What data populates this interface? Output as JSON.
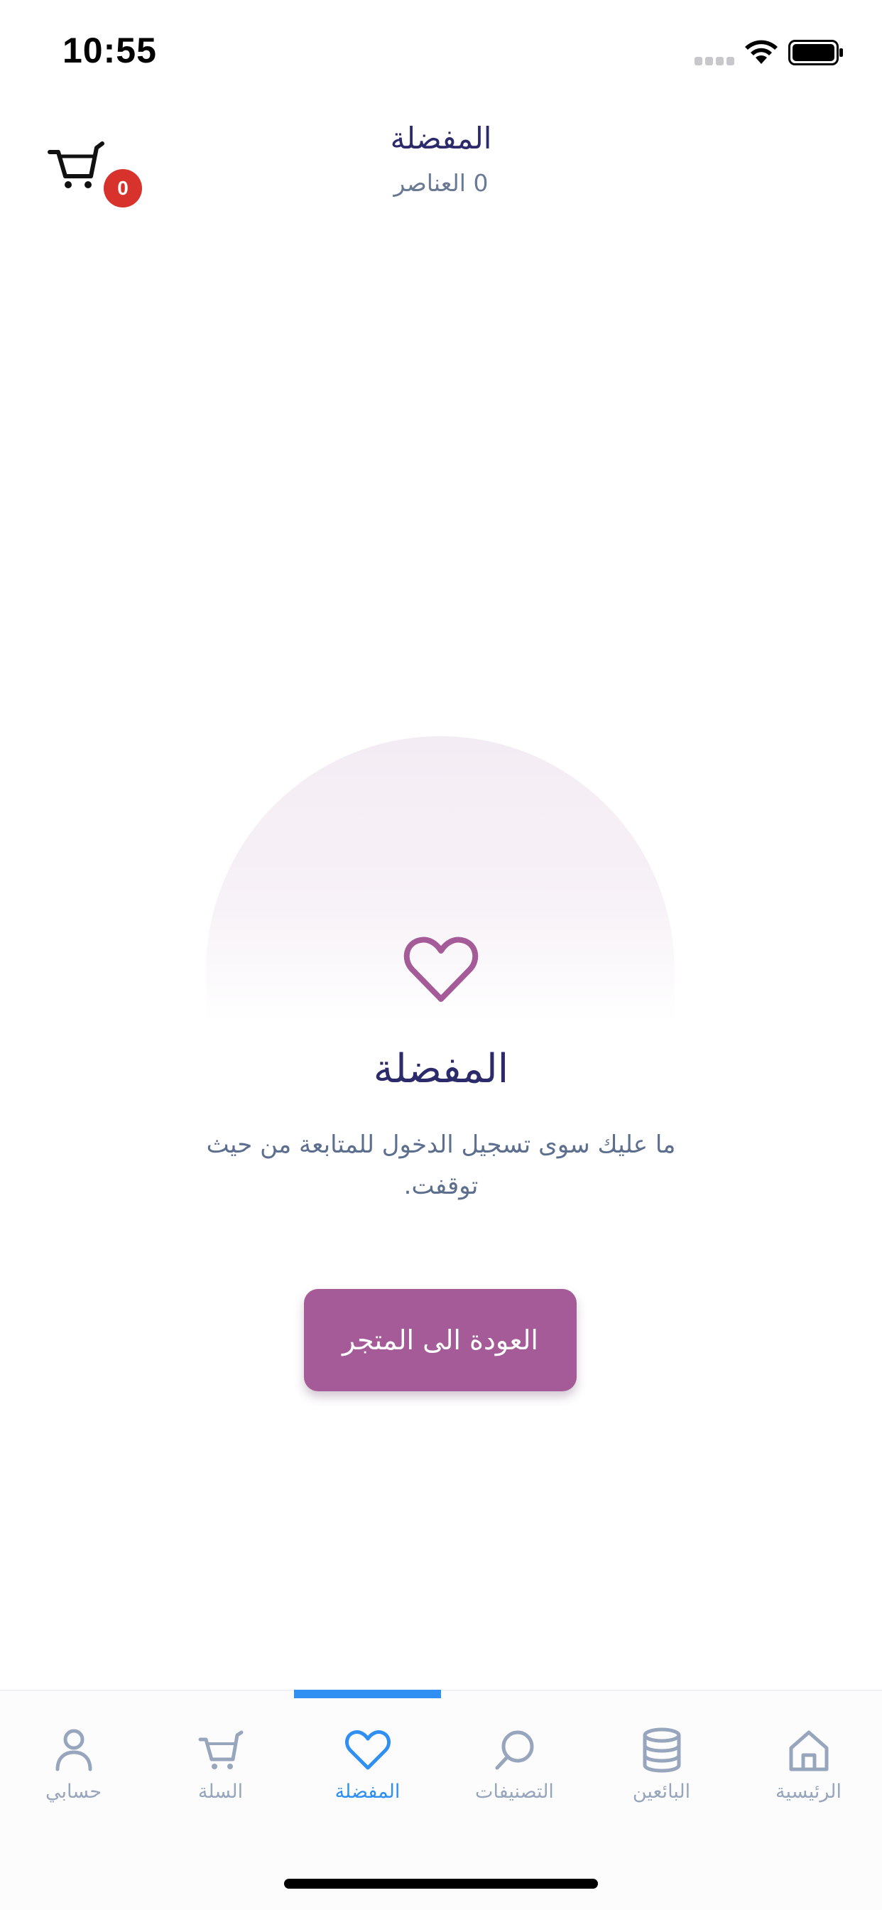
{
  "status_bar": {
    "time": "10:55"
  },
  "header": {
    "title": "المفضلة",
    "items_count": "0",
    "items_label": "العناصر",
    "cart_badge": "0"
  },
  "empty_state": {
    "title": "المفضلة",
    "description": "ما عليك سوى تسجيل الدخول للمتابعة من حيث توقفت."
  },
  "cta": {
    "label": "العودة الى المتجر"
  },
  "tabs": [
    {
      "label": "الرئيسية",
      "icon": "home-icon",
      "active": false
    },
    {
      "label": "البائعين",
      "icon": "database-icon",
      "active": false
    },
    {
      "label": "التصنيفات",
      "icon": "search-icon",
      "active": false
    },
    {
      "label": "المفضلة",
      "icon": "heart-icon",
      "active": true
    },
    {
      "label": "السلة",
      "icon": "cart-icon",
      "active": false
    },
    {
      "label": "حسابي",
      "icon": "user-icon",
      "active": false
    }
  ],
  "colors": {
    "accent": "#a55b97",
    "active_tab": "#2f8ff2",
    "title": "#2b2a6b",
    "badge": "#d7322c"
  }
}
